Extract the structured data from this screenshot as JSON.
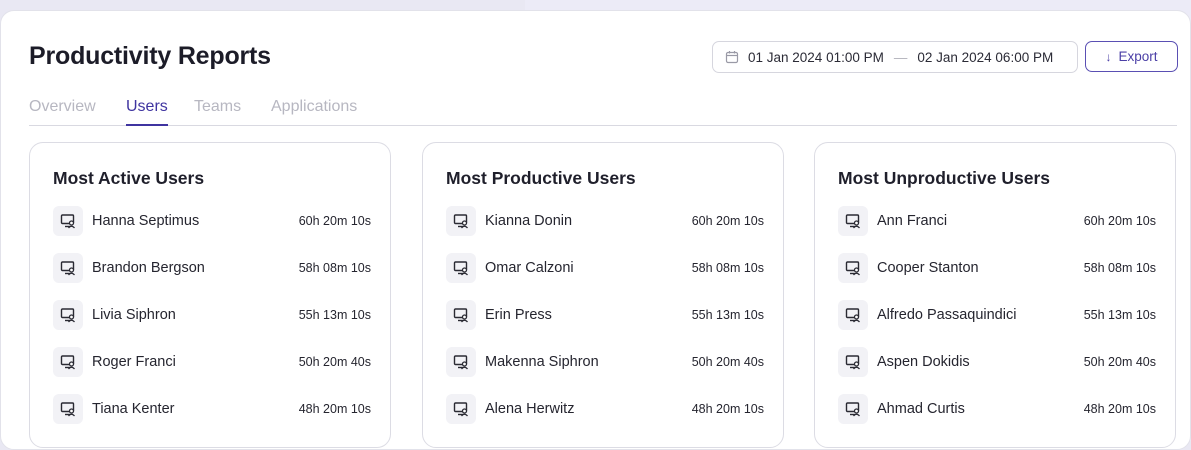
{
  "header": {
    "title": "Productivity Reports",
    "date_start": "01 Jan 2024 01:00 PM",
    "date_separator": "—",
    "date_end": "02 Jan 2024 06:00 PM",
    "export_label": "Export"
  },
  "tabs": [
    {
      "label": "Overview",
      "active": false
    },
    {
      "label": "Users",
      "active": true
    },
    {
      "label": "Teams",
      "active": false
    },
    {
      "label": "Applications",
      "active": false
    }
  ],
  "cards": [
    {
      "title": "Most Active Users",
      "users": [
        {
          "name": "Hanna Septimus",
          "time": "60h 20m 10s"
        },
        {
          "name": "Brandon Bergson",
          "time": "58h 08m 10s"
        },
        {
          "name": "Livia Siphron",
          "time": "55h 13m 10s"
        },
        {
          "name": "Roger Franci",
          "time": "50h 20m 40s"
        },
        {
          "name": "Tiana Kenter",
          "time": "48h 20m 10s"
        }
      ]
    },
    {
      "title": "Most Productive Users",
      "users": [
        {
          "name": "Kianna Donin",
          "time": "60h 20m 10s"
        },
        {
          "name": "Omar Calzoni",
          "time": "58h 08m 10s"
        },
        {
          "name": "Erin Press",
          "time": "55h 13m 10s"
        },
        {
          "name": "Makenna Siphron",
          "time": "50h 20m 40s"
        },
        {
          "name": "Alena Herwitz",
          "time": "48h 20m 10s"
        }
      ]
    },
    {
      "title": "Most Unproductive Users",
      "users": [
        {
          "name": "Ann Franci",
          "time": "60h 20m 10s"
        },
        {
          "name": "Cooper Stanton",
          "time": "58h 08m 10s"
        },
        {
          "name": "Alfredo Passaquindici",
          "time": "55h 13m 10s"
        },
        {
          "name": "Aspen Dokidis",
          "time": "50h 20m 40s"
        },
        {
          "name": "Ahmad Curtis",
          "time": "48h 20m 10s"
        }
      ]
    }
  ],
  "icons": {
    "date": "calendar-icon",
    "export": "download-arrow-icon",
    "user": "computer-user-icon"
  },
  "colors": {
    "accent": "#3f34a0",
    "tab_inactive": "#b7b7c1",
    "background": "#e9e8f3"
  }
}
